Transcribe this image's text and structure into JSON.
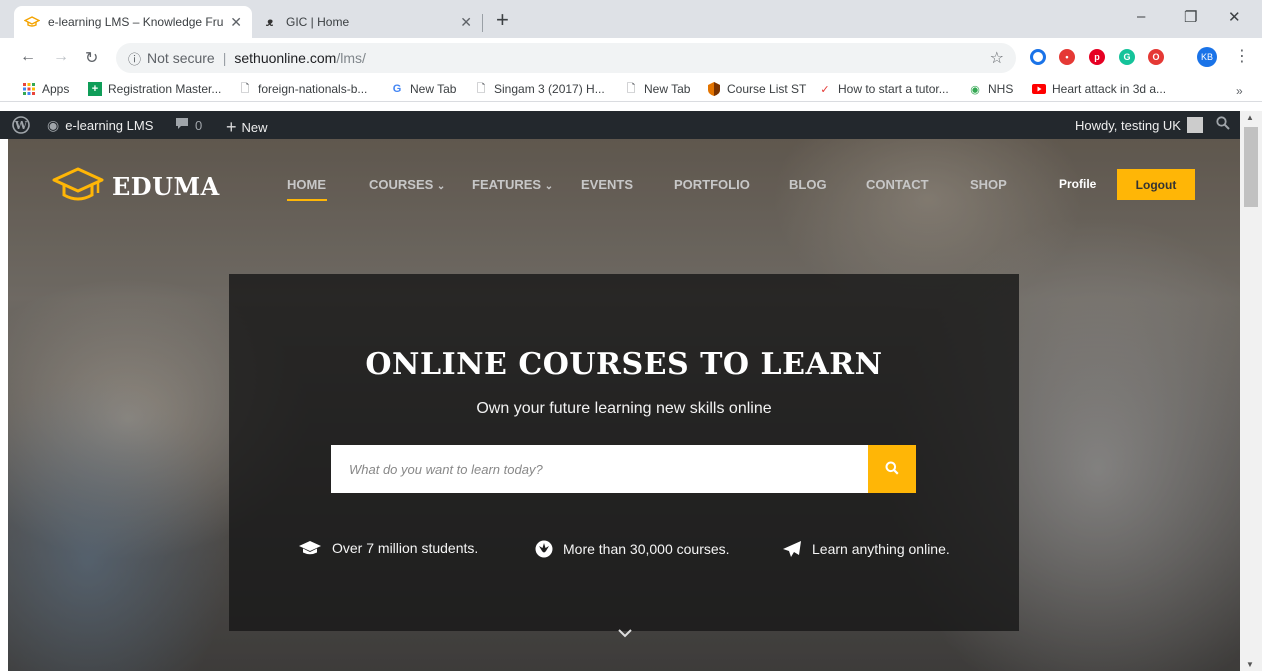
{
  "browser": {
    "tabs": [
      {
        "title": "e-learning LMS – Knowledge Fru",
        "active": true
      },
      {
        "title": "GIC | Home",
        "active": false
      }
    ],
    "new_tab": "+",
    "window_controls": [
      "–",
      "❐",
      "✕"
    ]
  },
  "omnibox": {
    "security_label": "Not secure",
    "host": "sethuonline.com",
    "path": "/lms/"
  },
  "extensions": [
    {
      "name": "opera-ext",
      "color": "#1a73e8"
    },
    {
      "name": "web-ext",
      "color": "#e53935"
    },
    {
      "name": "pinterest-ext",
      "color": "#e60023"
    },
    {
      "name": "grammarly-ext",
      "color": "#15c39a"
    },
    {
      "name": "adblock-ext",
      "color": "#e53935"
    }
  ],
  "profile": {
    "initials": "KB"
  },
  "bookmarks": [
    {
      "label": "Apps",
      "icon": "apps-grid-icon"
    },
    {
      "label": "Registration Master...",
      "icon": "plus-icon"
    },
    {
      "label": "foreign-nationals-b...",
      "icon": "page-icon"
    },
    {
      "label": "New Tab",
      "icon": "google-icon"
    },
    {
      "label": "Singam 3 (2017) H...",
      "icon": "page-icon"
    },
    {
      "label": "New Tab",
      "icon": "page-icon"
    },
    {
      "label": "Course List ST",
      "icon": "shield-icon"
    },
    {
      "label": "How to start a tutor...",
      "icon": "swoosh-icon"
    },
    {
      "label": "NHS",
      "icon": "nhs-icon"
    },
    {
      "label": "Heart attack in 3d a...",
      "icon": "youtube-icon"
    }
  ],
  "bookmarks_more": "»",
  "adminbar": {
    "site_name": "e-learning LMS",
    "comments_count": "0",
    "new_label": "New",
    "greeting": "Howdy, testing UK"
  },
  "site": {
    "logo_text": "EDUMA",
    "nav": [
      {
        "label": "HOME",
        "active": true
      },
      {
        "label": "COURSES",
        "dropdown": true
      },
      {
        "label": "FEATURES",
        "dropdown": true
      },
      {
        "label": "EVENTS"
      },
      {
        "label": "PORTFOLIO"
      },
      {
        "label": "BLOG"
      },
      {
        "label": "CONTACT"
      },
      {
        "label": "SHOP"
      }
    ],
    "profile_label": "Profile",
    "logout_label": "Logout",
    "accent_color": "#ffb606"
  },
  "hero": {
    "title": "ONLINE COURSES TO LEARN",
    "subtitle": "Own your future learning new skills online",
    "search_placeholder": "What do you want to learn today?",
    "features": [
      {
        "icon": "graduation-cap-icon",
        "text": "Over 7 million students."
      },
      {
        "icon": "rebel-icon",
        "text": "More than 30,000 courses."
      },
      {
        "icon": "paper-plane-icon",
        "text": "Learn anything online."
      }
    ]
  }
}
